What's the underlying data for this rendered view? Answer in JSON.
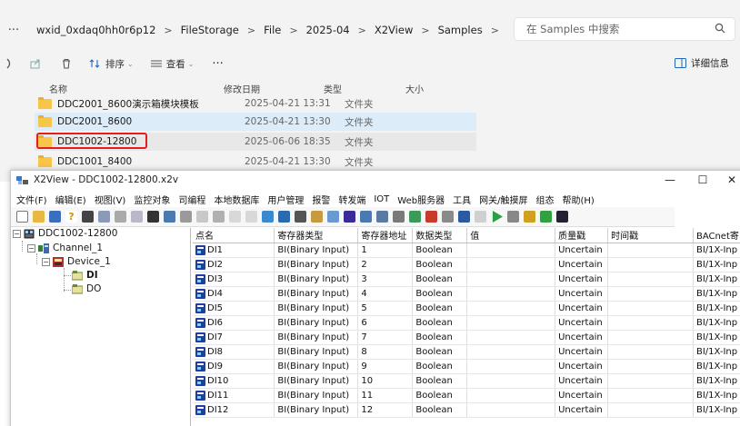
{
  "explorer": {
    "more_label": "···",
    "breadcrumbs": [
      "wxid_0xdaq0hh0r6p12",
      "FileStorage",
      "File",
      "2025-04",
      "X2View",
      "Samples"
    ],
    "separator": ">",
    "search_placeholder": "在 Samples 中搜索",
    "toolbar": {
      "sort_label": "排序",
      "view_label": "查看",
      "more_label": "···",
      "details_label": "详细信息"
    },
    "columns": {
      "name": "名称",
      "modified": "修改日期",
      "type": "类型",
      "size": "大小"
    },
    "files": [
      {
        "name": "DDC2001_8600演示箱模块模板",
        "modified": "2025-04-21 13:31",
        "type": "文件夹"
      },
      {
        "name": "DDC2001_8600",
        "modified": "2025-04-21 13:30",
        "type": "文件夹"
      },
      {
        "name": "DDC1002-12800",
        "modified": "2025-06-06 18:35",
        "type": "文件夹"
      },
      {
        "name": "DDC1001_8400",
        "modified": "2025-04-21 13:30",
        "type": "文件夹"
      }
    ]
  },
  "window": {
    "title": "X2View - DDC1002-12800.x2v",
    "controls": {
      "minimize": "—",
      "maximize": "☐",
      "close": "✕"
    },
    "menu": [
      "文件(F)",
      "编辑(E)",
      "视图(V)",
      "监控对象",
      "司编程",
      "本地数据库",
      "用户管理",
      "报警",
      "转发端",
      "IOT",
      "Web服务器",
      "工具",
      "网关/触摸屏",
      "组态",
      "帮助(H)"
    ],
    "tree": {
      "root": "DDC1002-12800",
      "channel": "Channel_1",
      "device": "Device_1",
      "leaves": [
        "DI",
        "DO"
      ]
    },
    "table": {
      "headers": [
        "点名",
        "寄存器类型",
        "寄存器地址",
        "数据类型",
        "值",
        "质量戳",
        "时间戳",
        "BACnet寄"
      ],
      "rows": [
        [
          "DI1",
          "BI(Binary Input)",
          "1",
          "Boolean",
          "",
          "Uncertain",
          "",
          "BI/1X-Inp"
        ],
        [
          "DI2",
          "BI(Binary Input)",
          "2",
          "Boolean",
          "",
          "Uncertain",
          "",
          "BI/1X-Inp"
        ],
        [
          "DI3",
          "BI(Binary Input)",
          "3",
          "Boolean",
          "",
          "Uncertain",
          "",
          "BI/1X-Inp"
        ],
        [
          "DI4",
          "BI(Binary Input)",
          "4",
          "Boolean",
          "",
          "Uncertain",
          "",
          "BI/1X-Inp"
        ],
        [
          "DI5",
          "BI(Binary Input)",
          "5",
          "Boolean",
          "",
          "Uncertain",
          "",
          "BI/1X-Inp"
        ],
        [
          "DI6",
          "BI(Binary Input)",
          "6",
          "Boolean",
          "",
          "Uncertain",
          "",
          "BI/1X-Inp"
        ],
        [
          "DI7",
          "BI(Binary Input)",
          "7",
          "Boolean",
          "",
          "Uncertain",
          "",
          "BI/1X-Inp"
        ],
        [
          "DI8",
          "BI(Binary Input)",
          "8",
          "Boolean",
          "",
          "Uncertain",
          "",
          "BI/1X-Inp"
        ],
        [
          "DI9",
          "BI(Binary Input)",
          "9",
          "Boolean",
          "",
          "Uncertain",
          "",
          "BI/1X-Inp"
        ],
        [
          "DI10",
          "BI(Binary Input)",
          "10",
          "Boolean",
          "",
          "Uncertain",
          "",
          "BI/1X-Inp"
        ],
        [
          "DI11",
          "BI(Binary Input)",
          "11",
          "Boolean",
          "",
          "Uncertain",
          "",
          "BI/1X-Inp"
        ],
        [
          "DI12",
          "BI(Binary Input)",
          "12",
          "Boolean",
          "",
          "Uncertain",
          "",
          "BI/1X-Inp"
        ]
      ]
    }
  },
  "colors": {
    "selection": "#dcecf9",
    "highlight_box": "#e02020",
    "folder": "#f7c548"
  }
}
